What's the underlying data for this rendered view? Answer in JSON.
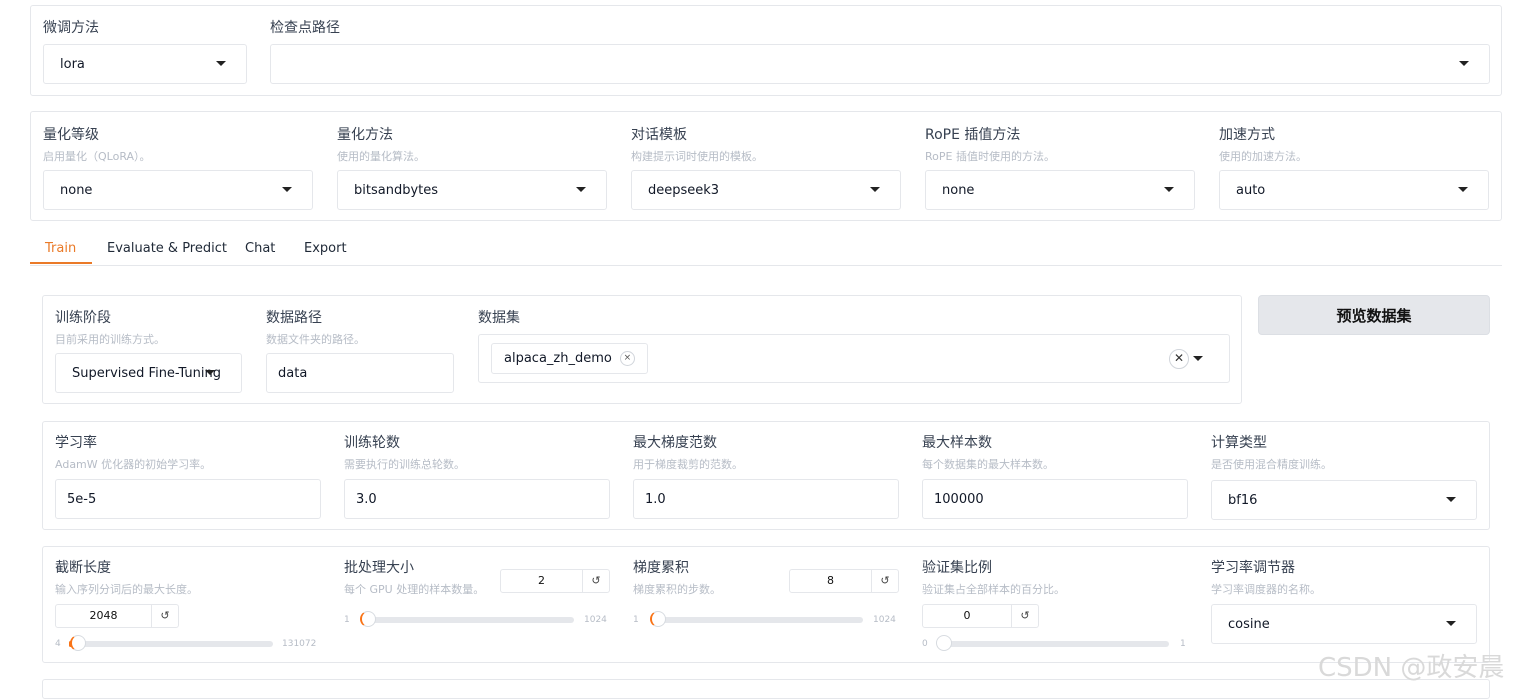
{
  "top": {
    "finetune_label": "微调方法",
    "finetune_value": "lora",
    "checkpoint_label": "检查点路径",
    "checkpoint_value": ""
  },
  "quant_row": [
    {
      "label": "量化等级",
      "hint": "启用量化（QLoRA）。",
      "value": "none"
    },
    {
      "label": "量化方法",
      "hint": "使用的量化算法。",
      "value": "bitsandbytes"
    },
    {
      "label": "对话模板",
      "hint": "构建提示词时使用的模板。",
      "value": "deepseek3"
    },
    {
      "label": "RoPE 插值方法",
      "hint": "RoPE 插值时使用的方法。",
      "value": "none"
    },
    {
      "label": "加速方式",
      "hint": "使用的加速方法。",
      "value": "auto"
    }
  ],
  "tabs": [
    "Train",
    "Evaluate & Predict",
    "Chat",
    "Export"
  ],
  "train": {
    "stage_label": "训练阶段",
    "stage_hint": "目前采用的训练方式。",
    "stage_value": "Supervised Fine-Tuning",
    "datadir_label": "数据路径",
    "datadir_hint": "数据文件夹的路径。",
    "datadir_value": "data",
    "dataset_label": "数据集",
    "dataset_chip": "alpaca_zh_demo",
    "preview_button": "预览数据集"
  },
  "params_row": [
    {
      "label": "学习率",
      "hint": "AdamW 优化器的初始学习率。",
      "value": "5e-5"
    },
    {
      "label": "训练轮数",
      "hint": "需要执行的训练总轮数。",
      "value": "3.0"
    },
    {
      "label": "最大梯度范数",
      "hint": "用于梯度裁剪的范数。",
      "value": "1.0"
    },
    {
      "label": "最大样本数",
      "hint": "每个数据集的最大样本数。",
      "value": "100000"
    },
    {
      "label": "计算类型",
      "hint": "是否使用混合精度训练。",
      "value": "bf16"
    }
  ],
  "sliders_row": {
    "cutoff": {
      "label": "截断长度",
      "hint": "输入序列分词后的最大长度。",
      "value": "2048",
      "min": "4",
      "max": "131072",
      "fraction": 0.0156
    },
    "batch": {
      "label": "批处理大小",
      "hint": "每个 GPU 处理的样本数量。",
      "value": "2",
      "min": "1",
      "max": "1024",
      "fraction": 0.001
    },
    "grad_accum": {
      "label": "梯度累积",
      "hint": "梯度累积的步数。",
      "value": "8",
      "min": "1",
      "max": "1024",
      "fraction": 0.007
    },
    "val_size": {
      "label": "验证集比例",
      "hint": "验证集占全部样本的百分比。",
      "value": "0",
      "min": "0",
      "max": "1",
      "fraction": 0.0
    },
    "scheduler": {
      "label": "学习率调节器",
      "hint": "学习率调度器的名称。",
      "value": "cosine"
    }
  },
  "icons": {
    "reset": "↺",
    "chip_close": "×",
    "clear": "✕"
  },
  "colors": {
    "accent": "#ea7a28",
    "slider_fill": "#f97316"
  },
  "watermark": "CSDN @政安晨"
}
